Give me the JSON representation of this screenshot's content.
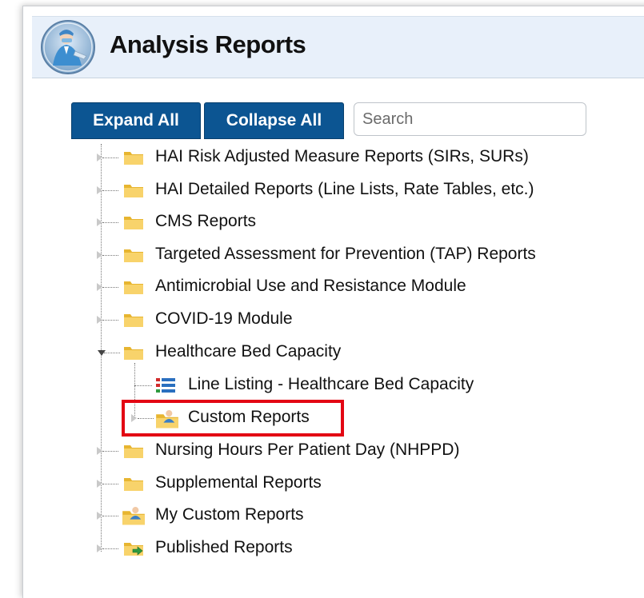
{
  "header": {
    "title": "Analysis Reports"
  },
  "toolbar": {
    "expand_label": "Expand All",
    "collapse_label": "Collapse All",
    "search_placeholder": "Search"
  },
  "tree": {
    "items": [
      {
        "label": "HAI Risk Adjusted Measure Reports (SIRs, SURs)",
        "icon": "folder-icon"
      },
      {
        "label": "HAI Detailed Reports (Line Lists, Rate Tables, etc.)",
        "icon": "folder-icon"
      },
      {
        "label": "CMS Reports",
        "icon": "folder-icon"
      },
      {
        "label": "Targeted Assessment for Prevention (TAP) Reports",
        "icon": "folder-icon"
      },
      {
        "label": "Antimicrobial Use and Resistance Module",
        "icon": "folder-icon"
      },
      {
        "label": "COVID-19 Module",
        "icon": "folder-icon"
      },
      {
        "label": "Healthcare Bed Capacity",
        "icon": "folder-icon",
        "expanded": true,
        "children": [
          {
            "label": "Line Listing - Healthcare Bed Capacity",
            "icon": "line-list-icon"
          },
          {
            "label": "Custom Reports",
            "icon": "custom-report-folder-icon",
            "highlighted": true
          }
        ]
      },
      {
        "label": "Nursing Hours Per Patient Day (NHPPD)",
        "icon": "folder-icon"
      },
      {
        "label": "Supplemental Reports",
        "icon": "folder-icon"
      },
      {
        "label": "My Custom Reports",
        "icon": "custom-report-folder-icon"
      },
      {
        "label": "Published Reports",
        "icon": "published-folder-icon"
      }
    ]
  },
  "colors": {
    "header_bg": "#e8f0fa",
    "button_bg": "#0c5592",
    "highlight_border": "#e30613",
    "folder": "#f5c54a"
  }
}
